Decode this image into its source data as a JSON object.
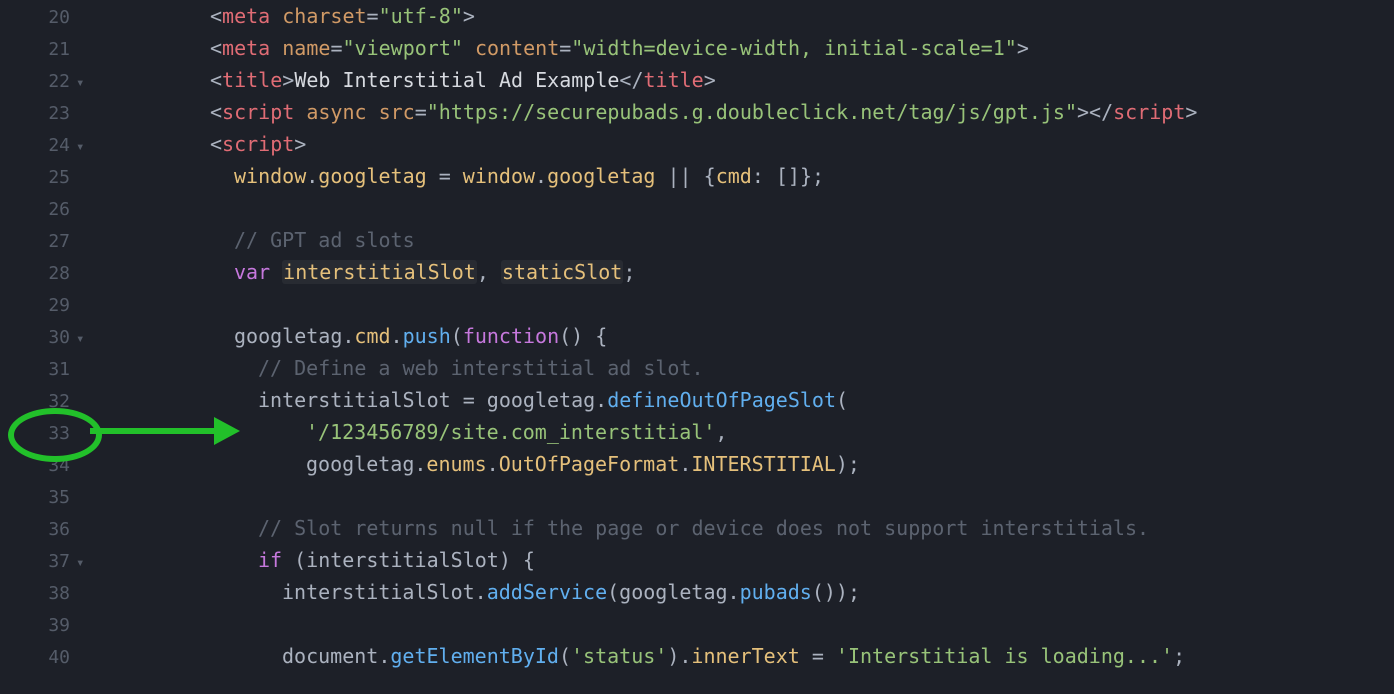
{
  "annotation": {
    "target_line": 33,
    "meaning": "ad-unit-path-string"
  },
  "lines": [
    {
      "num": 20,
      "fold": "",
      "tokens": [
        [
          "    ",
          "c-default"
        ],
        [
          "<",
          "c-punct"
        ],
        [
          "meta",
          "c-tag"
        ],
        [
          " charset",
          "c-attr"
        ],
        [
          "=",
          "c-punct"
        ],
        [
          "\"utf-8\"",
          "c-string"
        ],
        [
          ">",
          "c-punct"
        ]
      ]
    },
    {
      "num": 21,
      "fold": "",
      "tokens": [
        [
          "    ",
          "c-default"
        ],
        [
          "<",
          "c-punct"
        ],
        [
          "meta",
          "c-tag"
        ],
        [
          " name",
          "c-attr"
        ],
        [
          "=",
          "c-punct"
        ],
        [
          "\"viewport\"",
          "c-string"
        ],
        [
          " content",
          "c-attr"
        ],
        [
          "=",
          "c-punct"
        ],
        [
          "\"width=device-width, initial-scale=1\"",
          "c-string"
        ],
        [
          ">",
          "c-punct"
        ]
      ]
    },
    {
      "num": 22,
      "fold": "▾",
      "tokens": [
        [
          "    ",
          "c-default"
        ],
        [
          "<",
          "c-punct"
        ],
        [
          "title",
          "c-tag"
        ],
        [
          ">",
          "c-punct"
        ],
        [
          "Web Interstitial Ad Example",
          "c-default"
        ],
        [
          "</",
          "c-punct"
        ],
        [
          "title",
          "c-tag"
        ],
        [
          ">",
          "c-punct"
        ]
      ]
    },
    {
      "num": 23,
      "fold": "",
      "tokens": [
        [
          "    ",
          "c-default"
        ],
        [
          "<",
          "c-punct"
        ],
        [
          "script",
          "c-tag"
        ],
        [
          " async",
          "c-attr"
        ],
        [
          " src",
          "c-attr"
        ],
        [
          "=",
          "c-punct"
        ],
        [
          "\"https://securepubads.g.doubleclick.net/tag/js/gpt.js\"",
          "c-string"
        ],
        [
          ">",
          "c-punct"
        ],
        [
          "</",
          "c-punct"
        ],
        [
          "script",
          "c-tag"
        ],
        [
          ">",
          "c-punct"
        ]
      ]
    },
    {
      "num": 24,
      "fold": "▾",
      "tokens": [
        [
          "    ",
          "c-default"
        ],
        [
          "<",
          "c-punct"
        ],
        [
          "script",
          "c-tag"
        ],
        [
          ">",
          "c-punct"
        ]
      ]
    },
    {
      "num": 25,
      "fold": "",
      "tokens": [
        [
          "      ",
          "c-default"
        ],
        [
          "window",
          "c-prop"
        ],
        [
          ".",
          "c-punct"
        ],
        [
          "googletag",
          "c-prop"
        ],
        [
          " = ",
          "c-punct"
        ],
        [
          "window",
          "c-prop"
        ],
        [
          ".",
          "c-punct"
        ],
        [
          "googletag",
          "c-prop"
        ],
        [
          " || {",
          "c-punct"
        ],
        [
          "cmd",
          "c-prop"
        ],
        [
          ": []};",
          "c-punct"
        ]
      ]
    },
    {
      "num": 26,
      "fold": "",
      "tokens": [
        [
          "",
          "c-default"
        ]
      ]
    },
    {
      "num": 27,
      "fold": "",
      "tokens": [
        [
          "      ",
          "c-default"
        ],
        [
          "// GPT ad slots",
          "c-comment"
        ]
      ]
    },
    {
      "num": 28,
      "fold": "",
      "tokens": [
        [
          "      ",
          "c-default"
        ],
        [
          "var ",
          "c-keyword"
        ],
        [
          "interstitialSlot",
          "c-prop hl-var"
        ],
        [
          ", ",
          "c-punct"
        ],
        [
          "staticSlot",
          "c-prop hl-var"
        ],
        [
          ";",
          "c-punct"
        ]
      ]
    },
    {
      "num": 29,
      "fold": "",
      "tokens": [
        [
          "",
          "c-default"
        ]
      ]
    },
    {
      "num": 30,
      "fold": "▾",
      "tokens": [
        [
          "      ",
          "c-default"
        ],
        [
          "googletag",
          "c-var"
        ],
        [
          ".",
          "c-punct"
        ],
        [
          "cmd",
          "c-prop"
        ],
        [
          ".",
          "c-punct"
        ],
        [
          "push",
          "c-method"
        ],
        [
          "(",
          "c-punct"
        ],
        [
          "function",
          "c-keyword"
        ],
        [
          "() {",
          "c-punct"
        ]
      ]
    },
    {
      "num": 31,
      "fold": "",
      "tokens": [
        [
          "        ",
          "c-default"
        ],
        [
          "// Define a web interstitial ad slot.",
          "c-comment"
        ]
      ]
    },
    {
      "num": 32,
      "fold": "",
      "tokens": [
        [
          "        ",
          "c-default"
        ],
        [
          "interstitialSlot ",
          "c-var"
        ],
        [
          "= ",
          "c-punct"
        ],
        [
          "googletag",
          "c-var"
        ],
        [
          ".",
          "c-punct"
        ],
        [
          "defineOutOfPageSlot",
          "c-method"
        ],
        [
          "(",
          "c-punct"
        ]
      ]
    },
    {
      "num": 33,
      "fold": "",
      "tokens": [
        [
          "            ",
          "c-default"
        ],
        [
          "'/123456789/site.com_interstitial'",
          "c-string"
        ],
        [
          ",",
          "c-punct"
        ]
      ]
    },
    {
      "num": 34,
      "fold": "",
      "tokens": [
        [
          "            ",
          "c-default"
        ],
        [
          "googletag",
          "c-var"
        ],
        [
          ".",
          "c-punct"
        ],
        [
          "enums",
          "c-prop"
        ],
        [
          ".",
          "c-punct"
        ],
        [
          "OutOfPageFormat",
          "c-prop"
        ],
        [
          ".",
          "c-punct"
        ],
        [
          "INTERSTITIAL",
          "c-prop"
        ],
        [
          ");",
          "c-punct"
        ]
      ]
    },
    {
      "num": 35,
      "fold": "",
      "tokens": [
        [
          "",
          "c-default"
        ]
      ]
    },
    {
      "num": 36,
      "fold": "",
      "tokens": [
        [
          "        ",
          "c-default"
        ],
        [
          "// Slot returns null if the page or device does not support interstitials.",
          "c-comment"
        ]
      ]
    },
    {
      "num": 37,
      "fold": "▾",
      "tokens": [
        [
          "        ",
          "c-default"
        ],
        [
          "if ",
          "c-keyword"
        ],
        [
          "(interstitialSlot) {",
          "c-punct"
        ]
      ]
    },
    {
      "num": 38,
      "fold": "",
      "tokens": [
        [
          "          ",
          "c-default"
        ],
        [
          "interstitialSlot",
          "c-var"
        ],
        [
          ".",
          "c-punct"
        ],
        [
          "addService",
          "c-method"
        ],
        [
          "(",
          "c-punct"
        ],
        [
          "googletag",
          "c-var"
        ],
        [
          ".",
          "c-punct"
        ],
        [
          "pubads",
          "c-method"
        ],
        [
          "());",
          "c-punct"
        ]
      ]
    },
    {
      "num": 39,
      "fold": "",
      "tokens": [
        [
          "",
          "c-default"
        ]
      ]
    },
    {
      "num": 40,
      "fold": "",
      "tokens": [
        [
          "          ",
          "c-default"
        ],
        [
          "document",
          "c-var"
        ],
        [
          ".",
          "c-punct"
        ],
        [
          "getElementById",
          "c-method"
        ],
        [
          "(",
          "c-punct"
        ],
        [
          "'status'",
          "c-string"
        ],
        [
          ").",
          "c-punct"
        ],
        [
          "innerText",
          "c-prop"
        ],
        [
          " = ",
          "c-punct"
        ],
        [
          "'Interstitial is loading...'",
          "c-string"
        ],
        [
          ";",
          "c-punct"
        ]
      ]
    }
  ]
}
